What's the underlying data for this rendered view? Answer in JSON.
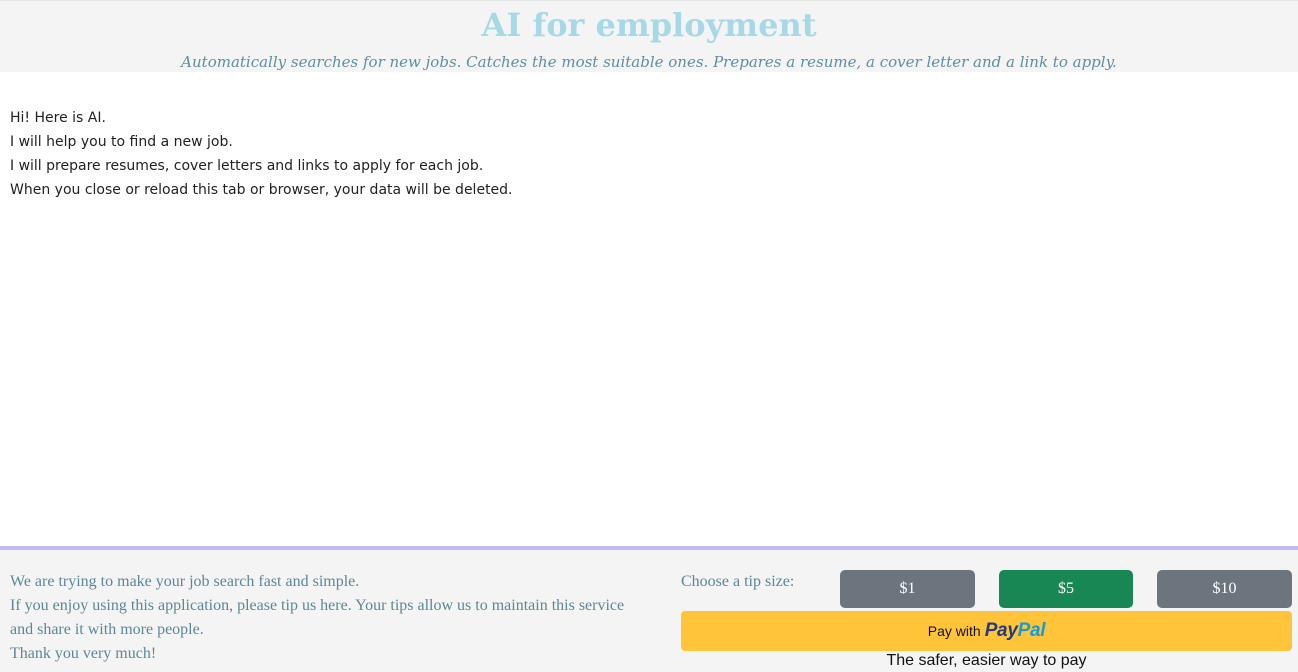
{
  "header": {
    "title": "AI for employment",
    "subtitle": "Automatically searches for new jobs. Catches the most suitable ones. Prepares a resume, a cover letter and a link to apply."
  },
  "messages": [
    "Hi! Here is AI.",
    "I will help you to find a new job.",
    "I will prepare resumes, cover letters and links to apply for each job.",
    "When you close or reload this tab or browser, your data will be deleted."
  ],
  "footer": {
    "tip_text": [
      "We are trying to make your job search fast and simple.",
      "If you enjoy using this application, please tip us here. Your tips allow us to maintain this service and share it with more people.",
      "Thank you very much!"
    ],
    "tip_label": "Choose a tip size:",
    "tip_options": [
      "$1",
      "$5",
      "$10"
    ],
    "selected_tip": "$5",
    "paypal": {
      "prefix": "Pay with",
      "logo_part1": "Pay",
      "logo_part2": "Pal",
      "tagline": "The safer, easier way to pay"
    }
  },
  "colors": {
    "title": "#a6d8e8",
    "subtitle": "#5e8fa0",
    "footer_border": "#c0baf0",
    "tip_button": "#6c757d",
    "tip_button_selected": "#198754",
    "paypal_button": "#ffc439"
  }
}
